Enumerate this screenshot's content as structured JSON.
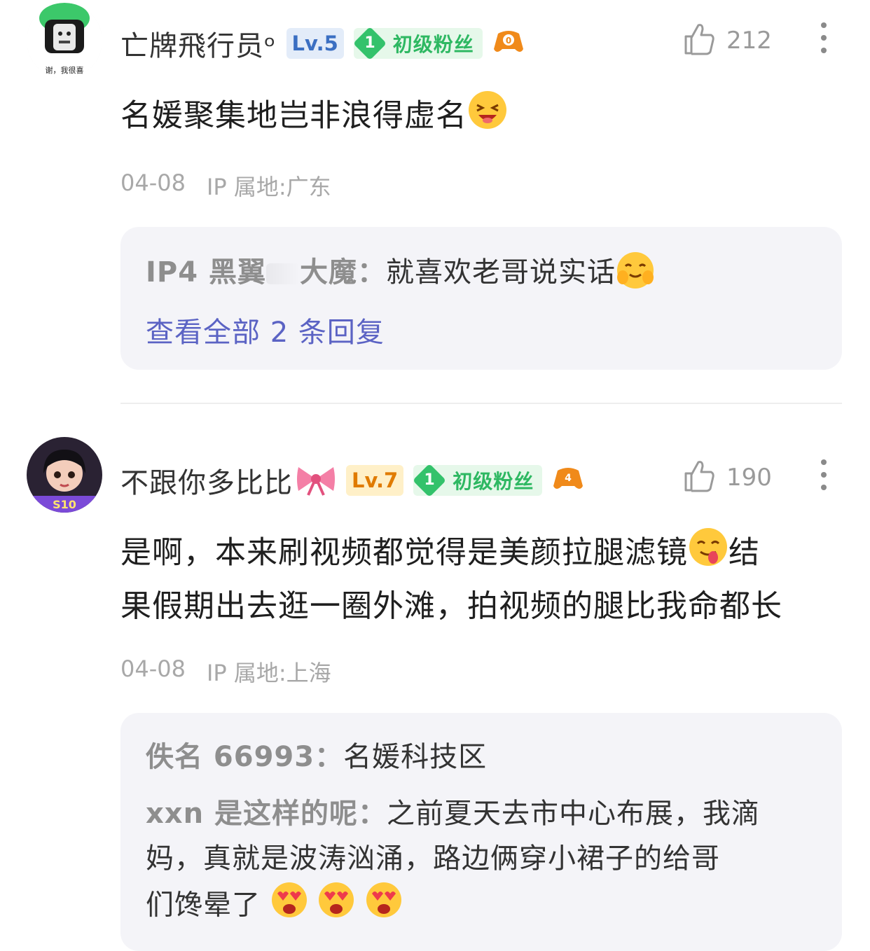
{
  "comments": [
    {
      "username": "亡牌飛行员ᵒ",
      "level": "Lv.5",
      "fan_badge": {
        "num": "1",
        "label": "初级粉丝"
      },
      "like_count": "212",
      "avatar_caption": "谢，我很喜",
      "content": "名媛聚集地岂非浪得虚名",
      "date": "04-08",
      "ip": "IP 属地:广东",
      "replies": [
        {
          "name": "IP4 黑翼",
          "name_suffix": "大魔",
          "text": "就喜欢老哥说实话"
        }
      ],
      "view_all": "查看全部 2 条回复"
    },
    {
      "username": "不跟你多比比",
      "level": "Lv.7",
      "fan_badge": {
        "num": "1",
        "label": "初级粉丝"
      },
      "like_count": "190",
      "avatar_caption": "S10",
      "content_line1": "是啊，本来刷视频都觉得是美颜拉腿滤镜",
      "content_line1b": "结",
      "content_line2": "果假期出去逛一圈外滩，拍视频的腿比我命都长",
      "date": "04-08",
      "ip": "IP 属地:上海",
      "replies": [
        {
          "name": "佚名 66993",
          "text": "名媛科技区"
        },
        {
          "name": "xxn 是这样的呢",
          "text_line1": "之前夏天去市中心布展，我滴",
          "text_line2": "妈，真就是波涛汹涌，路边俩穿小裙子的给哥",
          "text_line3": "们馋晕了"
        }
      ]
    }
  ],
  "colors": {
    "fan_green": "#33c26b",
    "reply_link": "#5b63c4",
    "reply_bg": "#f4f4f8",
    "meta_gray": "#a8a8a8"
  },
  "icons": [
    "thumbs-up-icon",
    "more-vertical-icon",
    "game-controller-icon",
    "grin-emoji",
    "blush-emoji",
    "bow-emoji",
    "yum-emoji",
    "heart-eyes-emoji"
  ]
}
